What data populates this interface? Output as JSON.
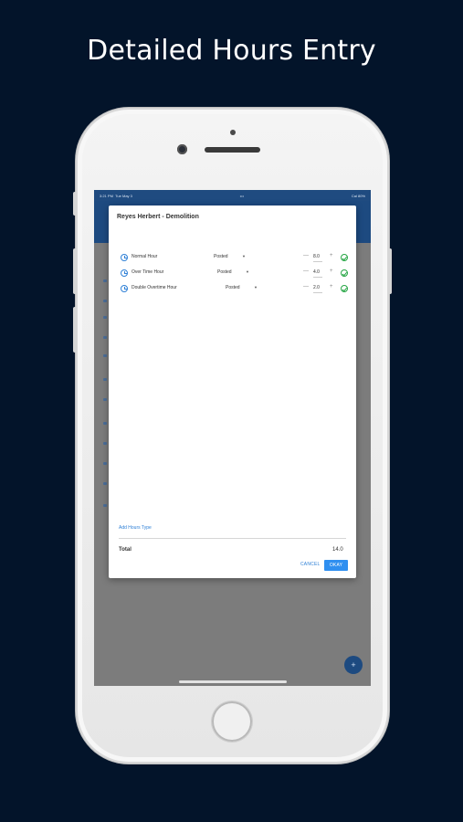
{
  "headline": "Detailed Hours Entry",
  "status_bar": {
    "time": "3:21 PM",
    "date": "Tue May 3",
    "center": "•••",
    "battery": "Cal 80%"
  },
  "dialog": {
    "title": "Reyes Herbert - Demolition",
    "rows": [
      {
        "type": "Normal Hour",
        "status": "Posted",
        "hours": "8.0",
        "minus": "—",
        "plus": "+"
      },
      {
        "type": "Over Time Hour",
        "status": "Posted",
        "hours": "4.0",
        "minus": "—",
        "plus": "+"
      },
      {
        "type": "Double Overtime Hour",
        "status": "Posted",
        "hours": "2.0",
        "minus": "—",
        "plus": "+"
      }
    ],
    "add_hours_type": "Add Hours Type",
    "total_label": "Total",
    "total_value": "14.0",
    "cancel_label": "CANCEL",
    "okay_label": "OKAY"
  },
  "fab_label": "+",
  "colors": {
    "background": "#03142a",
    "app_bar": "#1d4a80",
    "accent": "#2f8ff0",
    "success": "#27a645"
  }
}
